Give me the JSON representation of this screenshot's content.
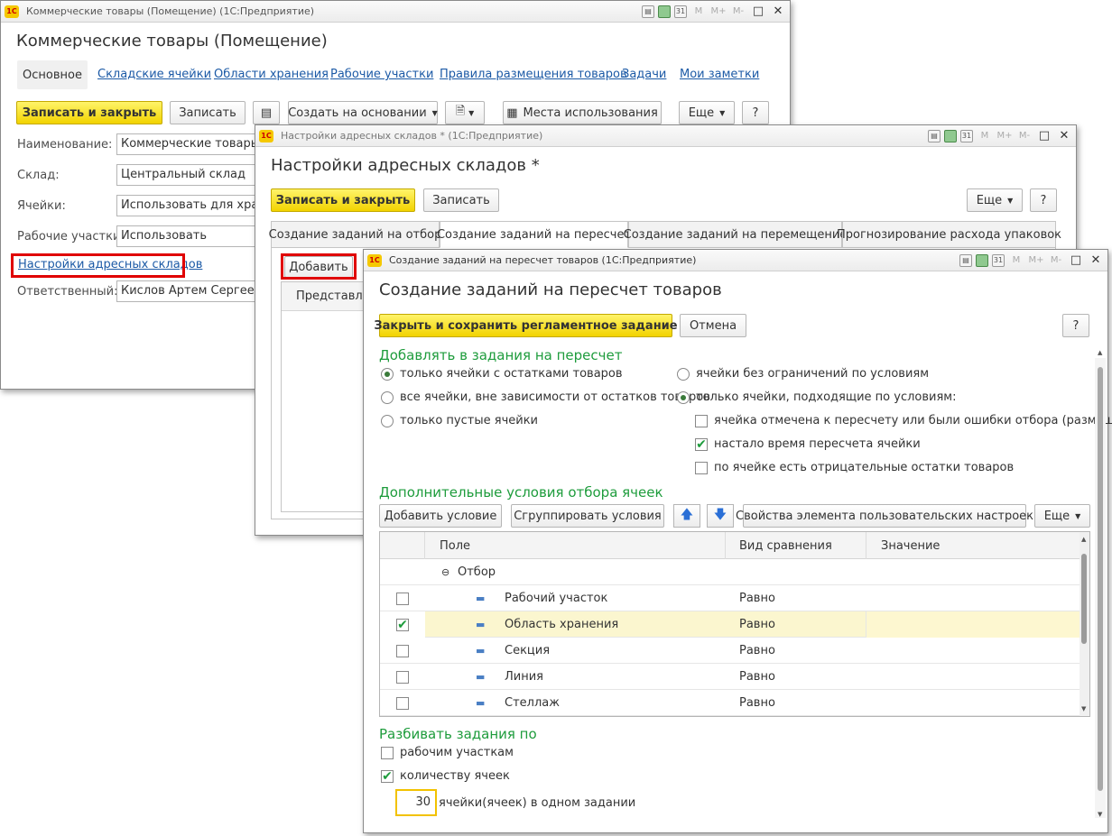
{
  "win1": {
    "title": "Коммерческие товары (Помещение) (1С:Предприятие)",
    "form_title": "Коммерческие товары (Помещение)",
    "tabs": [
      "Основное",
      "Складские ячейки",
      "Области хранения",
      "Рабочие участки",
      "Правила размещения товаров",
      "Задачи",
      "Мои заметки"
    ],
    "buttons": {
      "save_close": "Записать и закрыть",
      "save": "Записать",
      "create_based": "Создать на основании",
      "usage": "Места использования",
      "more": "Еще",
      "help": "?"
    },
    "fields": {
      "name_label": "Наименование:",
      "name_value": "Коммерческие товары",
      "warehouse_label": "Склад:",
      "warehouse_value": "Центральный склад",
      "cells_label": "Ячейки:",
      "cells_value": "Использовать для хранения",
      "areas_label": "Рабочие участки:",
      "areas_value": "Использовать",
      "settings_link": "Настройки адресных складов",
      "responsible_label": "Ответственный:",
      "responsible_value": "Кислов Артем Сергеевич"
    }
  },
  "win2": {
    "title": "Настройки адресных складов * (1С:Предприятие)",
    "form_title": "Настройки адресных складов *",
    "buttons": {
      "save_close": "Записать и закрыть",
      "save": "Записать",
      "more": "Еще",
      "help": "?",
      "add": "Добавить"
    },
    "tabs": [
      "Создание заданий на отбор",
      "Создание заданий на пересчет",
      "Создание заданий на перемещение",
      "Прогнозирование расхода упаковок"
    ],
    "column_header": "Представление"
  },
  "win3": {
    "title": "Создание заданий на пересчет товаров (1С:Предприятие)",
    "form_title": "Создание заданий на пересчет товаров",
    "buttons": {
      "close_save": "Закрыть и сохранить регламентное задание",
      "cancel": "Отмена",
      "help": "?",
      "add_condition": "Добавить условие",
      "group_conditions": "Сгруппировать условия",
      "element_props": "Свойства элемента пользовательских настроек",
      "more": "Еще"
    },
    "section_add": "Добавлять в задания на пересчет",
    "radios_left": [
      {
        "label": "только ячейки с остатками товаров",
        "checked": true
      },
      {
        "label": "все ячейки, вне зависимости от остатков товаров",
        "checked": false
      },
      {
        "label": "только пустые ячейки",
        "checked": false
      }
    ],
    "radios_right": [
      {
        "label": "ячейки без ограничений по условиям",
        "checked": false
      },
      {
        "label": "только ячейки, подходящие по условиям:",
        "checked": true
      }
    ],
    "sub_checks": [
      {
        "label": "ячейка отмечена к пересчету или были ошибки отбора (размещения)",
        "checked": false
      },
      {
        "label": "настало время пересчета ячейки",
        "checked": true
      },
      {
        "label": "по ячейке есть отрицательные остатки товаров",
        "checked": false
      }
    ],
    "section_conditions": "Дополнительные условия отбора ячеек",
    "grid": {
      "headers": [
        "Поле",
        "Вид сравнения",
        "Значение"
      ],
      "group": "Отбор",
      "rows": [
        {
          "field": "Рабочий участок",
          "comparison": "Равно",
          "checked": false,
          "selected": false
        },
        {
          "field": "Область хранения",
          "comparison": "Равно",
          "checked": true,
          "selected": true
        },
        {
          "field": "Секция",
          "comparison": "Равно",
          "checked": false,
          "selected": false
        },
        {
          "field": "Линия",
          "comparison": "Равно",
          "checked": false,
          "selected": false
        },
        {
          "field": "Стеллаж",
          "comparison": "Равно",
          "checked": false,
          "selected": false
        }
      ]
    },
    "section_split": "Разбивать задания по",
    "split_checks": [
      {
        "label": "рабочим участкам",
        "checked": false
      },
      {
        "label": "количеству ячеек",
        "checked": true
      }
    ],
    "cells_count": "30",
    "cells_count_label": "ячейки(ячеек) в одном задании"
  }
}
